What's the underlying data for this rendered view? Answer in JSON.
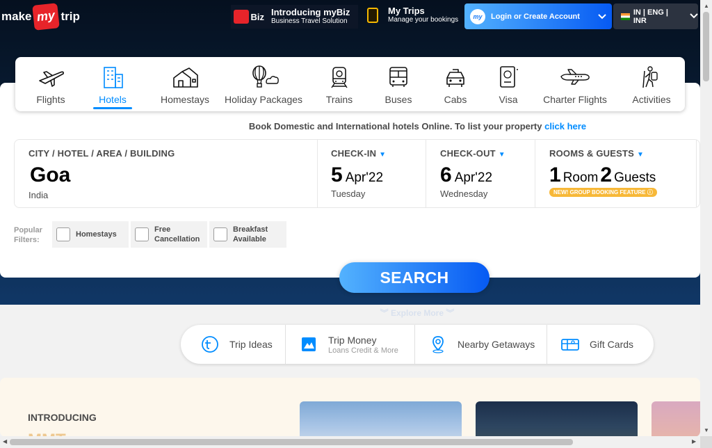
{
  "header": {
    "logo": {
      "left": "make",
      "badge": "my",
      "right": "trip"
    },
    "mybiz": {
      "icon_text": "Biz",
      "title": "Introducing myBiz",
      "subtitle": "Business Travel Solution"
    },
    "mytrips": {
      "title": "My Trips",
      "subtitle": "Manage your bookings"
    },
    "login": {
      "badge": "my",
      "label": "Login or Create Account"
    },
    "locale": {
      "label": "IN | ENG | INR"
    }
  },
  "nav": {
    "items": [
      {
        "label": "Flights",
        "icon": "plane-icon"
      },
      {
        "label": "Hotels",
        "icon": "hotel-icon",
        "active": true
      },
      {
        "label": "Homestays",
        "icon": "homestay-icon"
      },
      {
        "label": "Holiday Packages",
        "icon": "balloon-icon"
      },
      {
        "label": "Trains",
        "icon": "train-icon"
      },
      {
        "label": "Buses",
        "icon": "bus-icon"
      },
      {
        "label": "Cabs",
        "icon": "cab-icon"
      },
      {
        "label": "Visa",
        "icon": "passport-icon"
      },
      {
        "label": "Charter Flights",
        "icon": "charter-plane-icon"
      },
      {
        "label": "Activities",
        "icon": "hiker-icon"
      }
    ]
  },
  "booking_note": {
    "text": "Book Domestic and International hotels Online. To list your property ",
    "link": "click here"
  },
  "form": {
    "city": {
      "caption": "CITY / HOTEL / AREA / BUILDING",
      "value": "Goa",
      "sub": "India"
    },
    "checkin": {
      "caption": "CHECK-IN",
      "day": "5",
      "month": "Apr'22",
      "weekday": "Tuesday"
    },
    "checkout": {
      "caption": "CHECK-OUT",
      "day": "6",
      "month": "Apr'22",
      "weekday": "Wednesday"
    },
    "rooms": {
      "caption": "ROOMS & GUESTS",
      "rooms_count": "1",
      "rooms_label": "Room",
      "guests_count": "2",
      "guests_label": "Guests",
      "badge": "NEW! GROUP BOOKING FEATURE ⓘ"
    }
  },
  "filters": {
    "label_line1": "Popular",
    "label_line2": "Filters:",
    "items": [
      {
        "line1": "Homestays",
        "line2": ""
      },
      {
        "line1": "Free",
        "line2": "Cancellation"
      },
      {
        "line1": "Breakfast",
        "line2": "Available"
      }
    ]
  },
  "search_button": "SEARCH",
  "explore": "Explore More",
  "quick_links": [
    {
      "label": "Trip Ideas",
      "sub": "",
      "icon": "trip-ideas-icon"
    },
    {
      "label": "Trip Money",
      "sub": "Loans Credit & More",
      "icon": "trip-money-icon"
    },
    {
      "label": "Nearby Getaways",
      "sub": "",
      "icon": "location-pin-icon"
    },
    {
      "label": "Gift Cards",
      "sub": "",
      "icon": "gift-card-icon"
    }
  ],
  "promo": {
    "title": "INTRODUCING",
    "brand": "MMT"
  },
  "colors": {
    "accent": "#008cff",
    "brand_red": "#e7242a",
    "header_dark": "#081a30",
    "header_blue": "#103766"
  }
}
